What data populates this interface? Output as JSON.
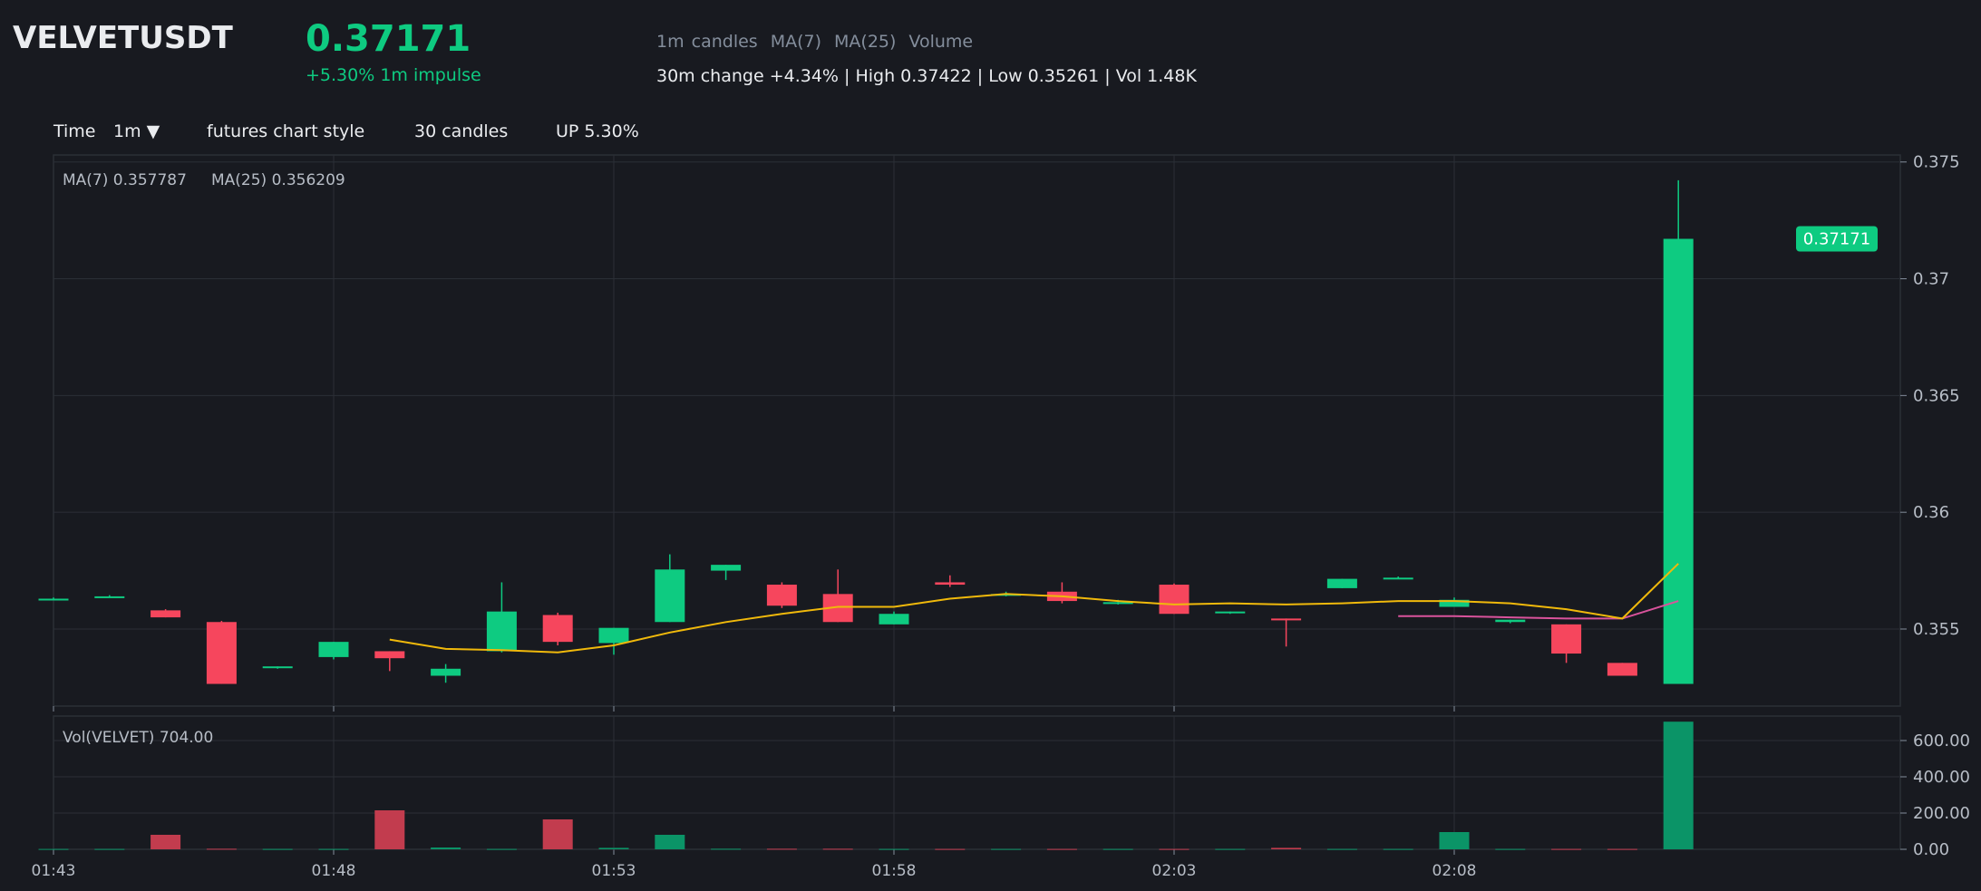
{
  "header": {
    "symbol": "VELVETUSDT",
    "price": "0.37171",
    "impulse": "+5.30% 1m impulse",
    "legend": [
      "1m candles",
      "MA(7)",
      "MA(25)",
      "Volume"
    ],
    "stats": "30m change +4.34% | High 0.37422 | Low 0.35261 | Vol 1.48K"
  },
  "toolbar": {
    "time_label": "Time",
    "interval": "1m ▼",
    "style": "futures chart style",
    "candles": "30 candles",
    "change": "UP 5.30%"
  },
  "colors": {
    "background": "#181a20",
    "up": "#0ecb81",
    "down": "#f6465d",
    "ma7": "#f0b90b",
    "ma25": "#d9539c",
    "grid": "#2b2f36",
    "text_muted": "#848e9c"
  },
  "chart_data": {
    "type": "candlestick",
    "interval": "1m",
    "ma_label": "MA(7) 0.357787",
    "ma25_label": "MA(25) 0.356209",
    "vol_label": "Vol(VELVET) 704.00",
    "last_price_label": "0.37171",
    "price_ticks": [
      "0.355",
      "0.36",
      "0.365",
      "0.37",
      "0.375"
    ],
    "volume_ticks": [
      "0.00",
      "200.00",
      "400.00",
      "600.00"
    ],
    "time_labels": [
      "01:43",
      "01:48",
      "01:53",
      "01:58",
      "02:03",
      "02:08"
    ],
    "ylim": [
      0.3517,
      0.3753
    ],
    "vol_max": 735,
    "candles": [
      {
        "t": 0,
        "o": 0.3563,
        "h": 0.35635,
        "l": 0.35625,
        "c": 0.3563,
        "v": 2
      },
      {
        "t": 1,
        "o": 0.3564,
        "h": 0.35645,
        "l": 0.35635,
        "c": 0.3564,
        "v": 2
      },
      {
        "t": 2,
        "o": 0.3558,
        "h": 0.35585,
        "l": 0.3555,
        "c": 0.3555,
        "v": 80
      },
      {
        "t": 3,
        "o": 0.3553,
        "h": 0.35535,
        "l": 0.35265,
        "c": 0.35265,
        "v": 3
      },
      {
        "t": 4,
        "o": 0.35335,
        "h": 0.3534,
        "l": 0.3533,
        "c": 0.3534,
        "v": 2
      },
      {
        "t": 5,
        "o": 0.3538,
        "h": 0.35445,
        "l": 0.3537,
        "c": 0.35445,
        "v": 2
      },
      {
        "t": 6,
        "o": 0.35405,
        "h": 0.35405,
        "l": 0.3532,
        "c": 0.35375,
        "v": 215
      },
      {
        "t": 7,
        "o": 0.353,
        "h": 0.3535,
        "l": 0.3527,
        "c": 0.3533,
        "v": 10
      },
      {
        "t": 8,
        "o": 0.35405,
        "h": 0.357,
        "l": 0.354,
        "c": 0.35575,
        "v": 2
      },
      {
        "t": 9,
        "o": 0.3556,
        "h": 0.3557,
        "l": 0.3543,
        "c": 0.35445,
        "v": 165
      },
      {
        "t": 10,
        "o": 0.3544,
        "h": 0.35505,
        "l": 0.3539,
        "c": 0.35505,
        "v": 8
      },
      {
        "t": 11,
        "o": 0.3553,
        "h": 0.3582,
        "l": 0.3553,
        "c": 0.35755,
        "v": 80
      },
      {
        "t": 12,
        "o": 0.3575,
        "h": 0.35775,
        "l": 0.3571,
        "c": 0.35775,
        "v": 3
      },
      {
        "t": 13,
        "o": 0.3569,
        "h": 0.357,
        "l": 0.3559,
        "c": 0.356,
        "v": 3
      },
      {
        "t": 14,
        "o": 0.3565,
        "h": 0.35755,
        "l": 0.3553,
        "c": 0.3553,
        "v": 3
      },
      {
        "t": 15,
        "o": 0.3552,
        "h": 0.35575,
        "l": 0.3552,
        "c": 0.35565,
        "v": 2
      },
      {
        "t": 16,
        "o": 0.357,
        "h": 0.3573,
        "l": 0.3568,
        "c": 0.3569,
        "v": 2
      },
      {
        "t": 17,
        "o": 0.3565,
        "h": 0.3566,
        "l": 0.3564,
        "c": 0.3565,
        "v": 2
      },
      {
        "t": 18,
        "o": 0.3566,
        "h": 0.357,
        "l": 0.3561,
        "c": 0.3562,
        "v": 2
      },
      {
        "t": 19,
        "o": 0.35615,
        "h": 0.35625,
        "l": 0.35605,
        "c": 0.35615,
        "v": 2
      },
      {
        "t": 20,
        "o": 0.3569,
        "h": 0.35695,
        "l": 0.35565,
        "c": 0.35565,
        "v": 2
      },
      {
        "t": 21,
        "o": 0.3557,
        "h": 0.35575,
        "l": 0.35565,
        "c": 0.35575,
        "v": 2
      },
      {
        "t": 22,
        "o": 0.35545,
        "h": 0.35545,
        "l": 0.35425,
        "c": 0.3554,
        "v": 8
      },
      {
        "t": 23,
        "o": 0.35675,
        "h": 0.35715,
        "l": 0.35675,
        "c": 0.35715,
        "v": 2
      },
      {
        "t": 24,
        "o": 0.3572,
        "h": 0.35725,
        "l": 0.35715,
        "c": 0.3572,
        "v": 2
      },
      {
        "t": 25,
        "o": 0.35595,
        "h": 0.35635,
        "l": 0.35595,
        "c": 0.35625,
        "v": 95
      },
      {
        "t": 26,
        "o": 0.3553,
        "h": 0.3554,
        "l": 0.35525,
        "c": 0.3554,
        "v": 2
      },
      {
        "t": 27,
        "o": 0.3552,
        "h": 0.3552,
        "l": 0.35355,
        "c": 0.35395,
        "v": 2
      },
      {
        "t": 28,
        "o": 0.35355,
        "h": 0.35355,
        "l": 0.353,
        "c": 0.353,
        "v": 2
      },
      {
        "t": 29,
        "o": 0.35265,
        "h": 0.37422,
        "l": 0.35265,
        "c": 0.37171,
        "v": 704
      }
    ],
    "ma7": [
      null,
      null,
      null,
      null,
      null,
      null,
      0.35455,
      0.35415,
      0.3541,
      0.354,
      0.3543,
      0.35485,
      0.3553,
      0.35565,
      0.35595,
      0.35595,
      0.3563,
      0.3565,
      0.3564,
      0.3562,
      0.35605,
      0.3561,
      0.35605,
      0.3561,
      0.3562,
      0.3562,
      0.3561,
      0.35585,
      0.35545,
      0.3578
    ],
    "ma25": [
      null,
      null,
      null,
      null,
      null,
      null,
      null,
      null,
      null,
      null,
      null,
      null,
      null,
      null,
      null,
      null,
      null,
      null,
      null,
      null,
      null,
      null,
      null,
      null,
      0.35555,
      0.35555,
      0.3555,
      0.35545,
      0.35545,
      0.3562
    ]
  }
}
